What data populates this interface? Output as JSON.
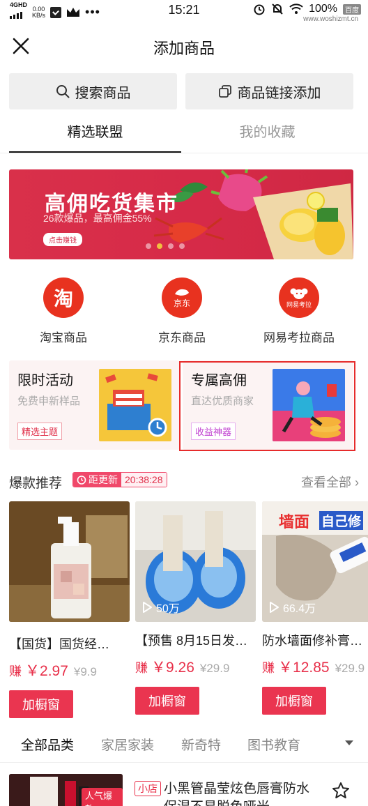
{
  "status_bar": {
    "network": "4GHD",
    "speed": "0.00",
    "speed_unit": "KB/s",
    "time": "15:21",
    "battery": "100%",
    "watermark_badge": "百度",
    "watermark": "www.woshizmt.cn"
  },
  "header": {
    "title": "添加商品",
    "close_icon": "close-icon"
  },
  "actions": {
    "search_label": "搜索商品",
    "link_label": "商品链接添加"
  },
  "tabs": [
    {
      "label": "精选联盟",
      "active": true
    },
    {
      "label": "我的收藏",
      "active": false
    }
  ],
  "banner": {
    "title": "高佣吃货集市",
    "subtitle": "26款爆品，最高佣金55%",
    "button": "点击赚钱",
    "dots": 4,
    "active_dot": 1
  },
  "platforms": [
    {
      "label": "淘宝商品",
      "icon_text": "淘",
      "color": "#e8321f"
    },
    {
      "label": "京东商品",
      "icon_text": "京东",
      "color": "#e0281e"
    },
    {
      "label": "网易考拉商品",
      "icon_text": "网易考拉",
      "color": "#e8321f"
    }
  ],
  "promos": [
    {
      "title": "限时活动",
      "subtitle": "免费申新样品",
      "tag": "精选主题"
    },
    {
      "title": "专属高佣",
      "subtitle": "直达优质商家",
      "tag": "收益神器"
    }
  ],
  "hot": {
    "title": "爆款推荐",
    "badge_label": "距更新",
    "countdown": "20:38:28",
    "view_all": "查看全部"
  },
  "products": [
    {
      "name": "【国货】国货经…",
      "earn_prefix": "赚",
      "earn": "￥2.97",
      "original": "¥9.9",
      "views": "",
      "button": "加橱窗"
    },
    {
      "name": "【预售 8月15日发…",
      "earn_prefix": "赚",
      "earn": "￥9.26",
      "original": "¥29.9",
      "views": "50万",
      "button": "加橱窗"
    },
    {
      "name": "防水墙面修补膏…",
      "earn_prefix": "赚",
      "earn": "￥12.85",
      "original": "¥29.9",
      "views": "66.4万",
      "button": "加橱窗",
      "img_text_1": "墙面",
      "img_text_2": "自己修"
    }
  ],
  "categories": [
    {
      "label": "全部品类",
      "active": true
    },
    {
      "label": "家居家装",
      "active": false
    },
    {
      "label": "新奇特",
      "active": false
    },
    {
      "label": "图书教育",
      "active": false
    }
  ],
  "list_item": {
    "image_tag": "人气爆款",
    "shop_tag": "小店",
    "title": "小黑管晶莹炫色唇膏防水保湿不易脱色哑光…"
  },
  "colors": {
    "accent": "#ea3550",
    "highlight": "#e62b2b",
    "banner": "#d62a48"
  }
}
